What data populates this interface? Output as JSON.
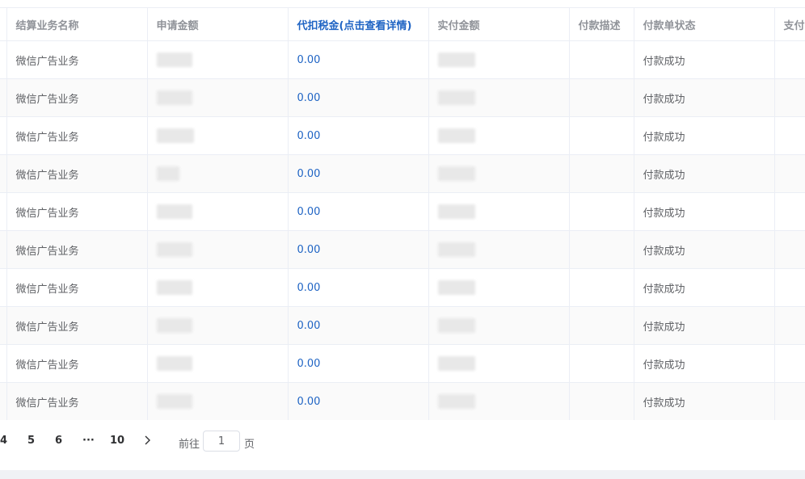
{
  "table": {
    "columns": [
      "",
      "结算业务名称",
      "申请金额",
      "代扣税金(点击查看详情)",
      "实付金额",
      "付款描述",
      "付款单状态",
      "支付"
    ],
    "rows": [
      {
        "name": "微信广告业务",
        "tax": "0.00",
        "status": "付款成功"
      },
      {
        "name": "微信广告业务",
        "tax": "0.00",
        "status": "付款成功"
      },
      {
        "name": "微信广告业务",
        "tax": "0.00",
        "status": "付款成功"
      },
      {
        "name": "微信广告业务",
        "tax": "0.00",
        "status": "付款成功"
      },
      {
        "name": "微信广告业务",
        "tax": "0.00",
        "status": "付款成功"
      },
      {
        "name": "微信广告业务",
        "tax": "0.00",
        "status": "付款成功"
      },
      {
        "name": "微信广告业务",
        "tax": "0.00",
        "status": "付款成功"
      },
      {
        "name": "微信广告业务",
        "tax": "0.00",
        "status": "付款成功"
      },
      {
        "name": "微信广告业务",
        "tax": "0.00",
        "status": "付款成功"
      },
      {
        "name": "微信广告业务",
        "tax": "0.00",
        "status": "付款成功"
      }
    ]
  },
  "pagination": {
    "pages": [
      "4",
      "5",
      "6",
      "···",
      "10"
    ],
    "goto_label": "前往",
    "goto_value": "1",
    "goto_suffix": "页"
  },
  "colors": {
    "link": "#1f64c4",
    "header_text": "#909399",
    "border": "#ebeef5"
  }
}
